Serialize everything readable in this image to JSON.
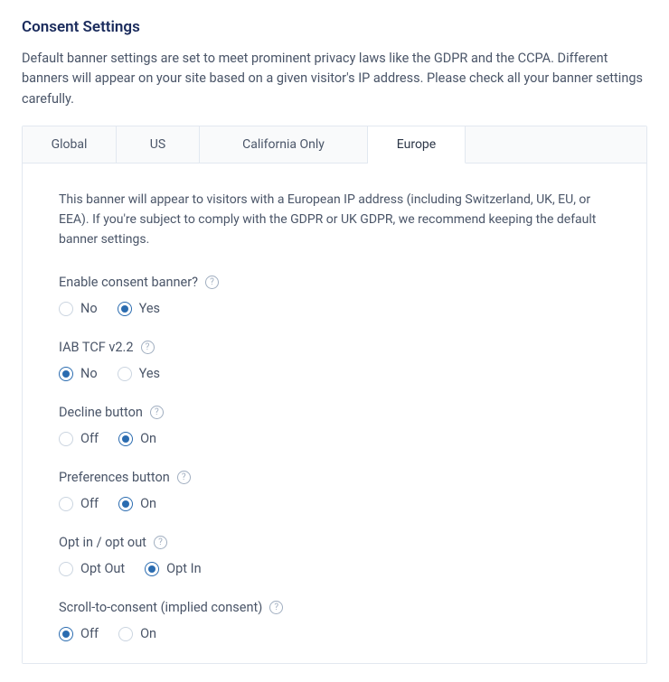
{
  "page": {
    "title": "Consent Settings",
    "description": "Default banner settings are set to meet prominent privacy laws like the GDPR and the CCPA. Different banners will appear on your site based on a given visitor's IP address. Please check all your banner settings carefully."
  },
  "tabs": [
    {
      "label": "Global",
      "active": false
    },
    {
      "label": "US",
      "active": false
    },
    {
      "label": "California Only",
      "active": false
    },
    {
      "label": "Europe",
      "active": true
    }
  ],
  "panel": {
    "description": "This banner will appear to visitors with a European IP address (including Switzerland, UK, EU, or EEA). If you're subject to comply with the GDPR or UK GDPR, we recommend keeping the default banner settings."
  },
  "fields": {
    "enable_banner": {
      "label": "Enable consent banner?",
      "options": [
        "No",
        "Yes"
      ],
      "selected": "Yes"
    },
    "iab_tcf": {
      "label": "IAB TCF v2.2",
      "options": [
        "No",
        "Yes"
      ],
      "selected": "No"
    },
    "decline_button": {
      "label": "Decline button",
      "options": [
        "Off",
        "On"
      ],
      "selected": "On"
    },
    "preferences_button": {
      "label": "Preferences button",
      "options": [
        "Off",
        "On"
      ],
      "selected": "On"
    },
    "opt_in_out": {
      "label": "Opt in / opt out",
      "options": [
        "Opt Out",
        "Opt In"
      ],
      "selected": "Opt In"
    },
    "scroll_consent": {
      "label": "Scroll-to-consent (implied consent)",
      "options": [
        "Off",
        "On"
      ],
      "selected": "Off"
    }
  },
  "help_glyph": "?"
}
